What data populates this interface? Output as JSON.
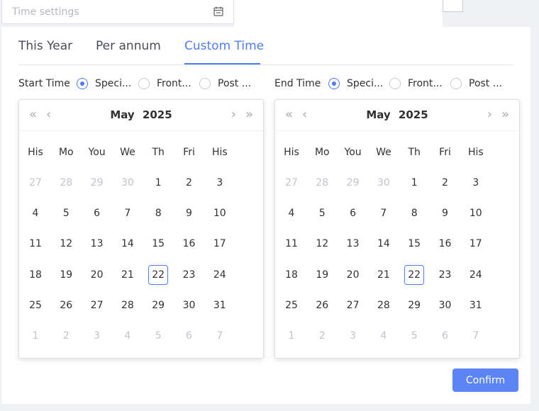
{
  "top_input": {
    "placeholder": "Time settings",
    "icon": "calendar-icon"
  },
  "tabs": [
    {
      "label": "This Year",
      "active": false
    },
    {
      "label": "Per annum",
      "active": false
    },
    {
      "label": "Custom Time",
      "active": true
    }
  ],
  "start": {
    "label": "Start Time",
    "options": [
      {
        "label": "Speci...",
        "checked": true
      },
      {
        "label": "Front...",
        "checked": false
      },
      {
        "label": "Post ...",
        "checked": false
      }
    ]
  },
  "end": {
    "label": "End Time",
    "options": [
      {
        "label": "Speci...",
        "checked": true
      },
      {
        "label": "Front...",
        "checked": false
      },
      {
        "label": "Post ...",
        "checked": false
      }
    ]
  },
  "calendar_left": {
    "month": "May",
    "year": "2025",
    "weekdays": [
      "His",
      "Mo",
      "You",
      "We",
      "Th",
      "Fri",
      "His"
    ],
    "today": "22",
    "rows": [
      [
        {
          "d": "27",
          "muted": true
        },
        {
          "d": "28",
          "muted": true
        },
        {
          "d": "29",
          "muted": true
        },
        {
          "d": "30",
          "muted": true
        },
        {
          "d": "1"
        },
        {
          "d": "2"
        },
        {
          "d": "3"
        }
      ],
      [
        {
          "d": "4"
        },
        {
          "d": "5"
        },
        {
          "d": "6"
        },
        {
          "d": "7"
        },
        {
          "d": "8"
        },
        {
          "d": "9"
        },
        {
          "d": "10"
        }
      ],
      [
        {
          "d": "11"
        },
        {
          "d": "12"
        },
        {
          "d": "13"
        },
        {
          "d": "14"
        },
        {
          "d": "15"
        },
        {
          "d": "16"
        },
        {
          "d": "17"
        }
      ],
      [
        {
          "d": "18"
        },
        {
          "d": "19"
        },
        {
          "d": "20"
        },
        {
          "d": "21"
        },
        {
          "d": "22",
          "today": true
        },
        {
          "d": "23"
        },
        {
          "d": "24"
        }
      ],
      [
        {
          "d": "25"
        },
        {
          "d": "26"
        },
        {
          "d": "27"
        },
        {
          "d": "28"
        },
        {
          "d": "29"
        },
        {
          "d": "30"
        },
        {
          "d": "31"
        }
      ],
      [
        {
          "d": "1",
          "muted": true
        },
        {
          "d": "2",
          "muted": true
        },
        {
          "d": "3",
          "muted": true
        },
        {
          "d": "4",
          "muted": true
        },
        {
          "d": "5",
          "muted": true
        },
        {
          "d": "6",
          "muted": true
        },
        {
          "d": "7",
          "muted": true
        }
      ]
    ]
  },
  "calendar_right": {
    "month": "May",
    "year": "2025",
    "weekdays": [
      "His",
      "Mo",
      "You",
      "We",
      "Th",
      "Fri",
      "His"
    ],
    "today": "22",
    "rows": [
      [
        {
          "d": "27",
          "muted": true
        },
        {
          "d": "28",
          "muted": true
        },
        {
          "d": "29",
          "muted": true
        },
        {
          "d": "30",
          "muted": true
        },
        {
          "d": "1"
        },
        {
          "d": "2"
        },
        {
          "d": "3"
        }
      ],
      [
        {
          "d": "4"
        },
        {
          "d": "5"
        },
        {
          "d": "6"
        },
        {
          "d": "7"
        },
        {
          "d": "8"
        },
        {
          "d": "9"
        },
        {
          "d": "10"
        }
      ],
      [
        {
          "d": "11"
        },
        {
          "d": "12"
        },
        {
          "d": "13"
        },
        {
          "d": "14"
        },
        {
          "d": "15"
        },
        {
          "d": "16"
        },
        {
          "d": "17"
        }
      ],
      [
        {
          "d": "18"
        },
        {
          "d": "19"
        },
        {
          "d": "20"
        },
        {
          "d": "21"
        },
        {
          "d": "22",
          "today": true
        },
        {
          "d": "23"
        },
        {
          "d": "24"
        }
      ],
      [
        {
          "d": "25"
        },
        {
          "d": "26"
        },
        {
          "d": "27"
        },
        {
          "d": "28"
        },
        {
          "d": "29"
        },
        {
          "d": "30"
        },
        {
          "d": "31"
        }
      ],
      [
        {
          "d": "1",
          "muted": true
        },
        {
          "d": "2",
          "muted": true
        },
        {
          "d": "3",
          "muted": true
        },
        {
          "d": "4",
          "muted": true
        },
        {
          "d": "5",
          "muted": true
        },
        {
          "d": "6",
          "muted": true
        },
        {
          "d": "7",
          "muted": true
        }
      ]
    ]
  },
  "nav": {
    "prev_year": "«",
    "prev_month": "‹",
    "next_month": "›",
    "next_year": "»"
  },
  "confirm_label": "Confirm",
  "colors": {
    "accent": "#4f7cf7",
    "muted": "#c0c4cc",
    "button": "#5b84f7"
  }
}
